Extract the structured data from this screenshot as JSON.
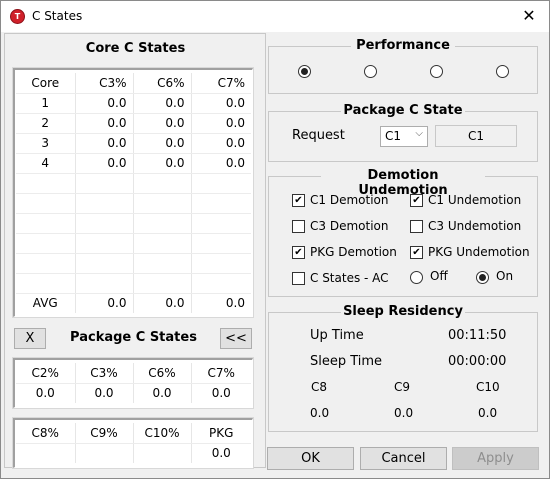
{
  "window": {
    "title": "C States",
    "app_icon_letter": "T",
    "close_glyph": "✕"
  },
  "core": {
    "title": "Core C States",
    "headers": [
      "Core",
      "C3%",
      "C6%",
      "C7%"
    ],
    "rows": [
      [
        "1",
        "0.0",
        "0.0",
        "0.0"
      ],
      [
        "2",
        "0.0",
        "0.0",
        "0.0"
      ],
      [
        "3",
        "0.0",
        "0.0",
        "0.0"
      ],
      [
        "4",
        "0.0",
        "0.0",
        "0.0"
      ]
    ],
    "avg": [
      "AVG",
      "0.0",
      "0.0",
      "0.0"
    ]
  },
  "package": {
    "title": "Package C States",
    "x_button": "X",
    "collapse_button": "<<",
    "table1_headers": [
      "C2%",
      "C3%",
      "C6%",
      "C7%"
    ],
    "table1_values": [
      "0.0",
      "0.0",
      "0.0",
      "0.0"
    ],
    "table2_headers": [
      "C8%",
      "C9%",
      "C10%",
      "PKG"
    ],
    "table2_values": [
      "",
      "",
      "",
      "0.0"
    ]
  },
  "performance": {
    "title": "Performance",
    "options_count": 4,
    "selected_index": 0
  },
  "package_c_state": {
    "title": "Package C State",
    "request_label": "Request",
    "select_value": "C1",
    "readout": "C1"
  },
  "demotion": {
    "title": "Demotion Undemotion",
    "c1_demotion": {
      "label": "C1 Demotion",
      "checked": true
    },
    "c1_undemotion": {
      "label": "C1 Undemotion",
      "checked": true
    },
    "c3_demotion": {
      "label": "C3 Demotion",
      "checked": false
    },
    "c3_undemotion": {
      "label": "C3 Undemotion",
      "checked": false
    },
    "pkg_demotion": {
      "label": "PKG Demotion",
      "checked": true
    },
    "pkg_undemotion": {
      "label": "PKG Undemotion",
      "checked": true
    },
    "c_states_ac": {
      "label": "C States - AC",
      "checked": false
    },
    "off_label": "Off",
    "on_label": "On",
    "on_selected": true
  },
  "sleep": {
    "title": "Sleep Residency",
    "up_time_label": "Up Time",
    "up_time_value": "00:11:50",
    "sleep_time_label": "Sleep Time",
    "sleep_time_value": "00:00:00",
    "c8_label": "C8",
    "c9_label": "C9",
    "c10_label": "C10",
    "c8_value": "0.0",
    "c9_value": "0.0",
    "c10_value": "0.0"
  },
  "buttons": {
    "ok": "OK",
    "cancel": "Cancel",
    "apply": "Apply"
  }
}
